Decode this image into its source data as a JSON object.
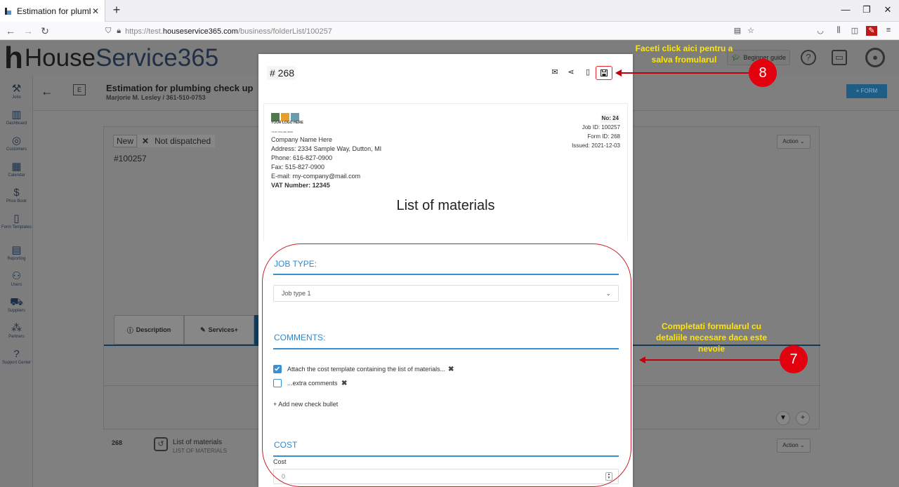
{
  "browser": {
    "tab_title": "Estimation for plumbing check up",
    "url_prefix": "https://test.",
    "url_domain": "houseservice365.com",
    "url_path": "/business/folderList/100257"
  },
  "app": {
    "logo_part1": "House",
    "logo_part2": "Service365",
    "beginner_guide": "Beginner guide",
    "sidebar": [
      {
        "icon": "tools-icon",
        "label": "Jobs"
      },
      {
        "icon": "dashboard-icon",
        "label": "Dashboard"
      },
      {
        "icon": "customers-icon",
        "label": "Customers"
      },
      {
        "icon": "calendar-icon",
        "label": "Calendar"
      },
      {
        "icon": "pricebook-icon",
        "label": "Price Book"
      },
      {
        "icon": "form-templates-icon",
        "label": "Form Templates"
      },
      {
        "icon": "reporting-icon",
        "label": "Reporting"
      },
      {
        "icon": "users-icon",
        "label": "Users"
      },
      {
        "icon": "suppliers-icon",
        "label": "Suppliers"
      },
      {
        "icon": "partners-icon",
        "label": "Partners"
      },
      {
        "icon": "support-icon",
        "label": "Support Center"
      }
    ],
    "e_badge": "E",
    "job_title": "Estimation for plumbing check up",
    "job_subtitle": "Marjorie M. Lesley / 361-510-0753",
    "form_button": "+ FORM",
    "status_new": "New",
    "status_dispatch": "Not dispatched",
    "job_id": "#100257",
    "action_label": "Action",
    "tabs": [
      "Description",
      "Services+"
    ],
    "row": {
      "num": "268",
      "name": "List of materials",
      "sub": "LIST OF MATERIALS"
    }
  },
  "modal": {
    "number": "# 268",
    "company": {
      "logo_text": "YOUR LOGO HERE",
      "tagline": "YOUR TAGLINE HERE",
      "name": "Company Name Here",
      "address": "Address: 2334 Sample Way, Dutton, MI",
      "phone": "Phone: 616-827-0900",
      "fax": "Fax: 515-827-0900",
      "email": "E-mail: my-company@mail.com",
      "vat": "VAT Number: 12345"
    },
    "meta": {
      "no": "No: 24",
      "job_id": "Job ID: 100257",
      "form_id": "Form ID: 268",
      "issued": "Issued: 2021-12-03"
    },
    "list_title": "List of materials",
    "job_type_header": "JOB TYPE:",
    "job_type_value": "Job type 1",
    "comments_header": "COMMENTS:",
    "comments": [
      {
        "text": "Attach the cost template containing the list of materials...",
        "checked": true
      },
      {
        "text": "...extra comments",
        "checked": false
      }
    ],
    "add_bullet": "+ Add new check bullet",
    "cost_header": "COST",
    "cost_label": "Cost",
    "cost_value": "0"
  },
  "annotations": {
    "save_note": "Faceti click aici pentru a salva fromularul",
    "save_step": "8",
    "fill_note": "Completati formularul cu detaliile necesare daca este nevoie",
    "fill_step": "7"
  }
}
